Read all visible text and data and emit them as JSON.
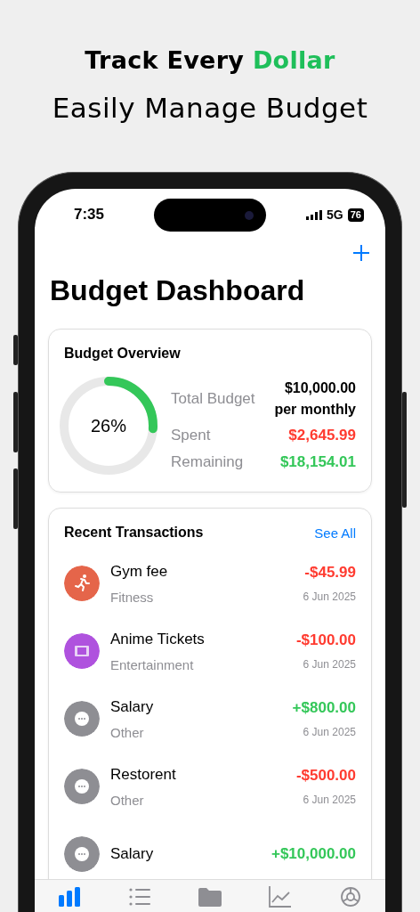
{
  "headline": {
    "parts": [
      {
        "text": "Track Every ",
        "highlight": false
      },
      {
        "text": "Dollar",
        "highlight": true
      }
    ],
    "subtitle": "Easily Manage Budget"
  },
  "status_bar": {
    "time": "7:35",
    "network": "5G",
    "battery": "76"
  },
  "title": "Budget Dashboard",
  "overview": {
    "title": "Budget Overview",
    "level": 0.26,
    "percent": "26%",
    "rows": [
      {
        "label": "Total Budget",
        "value": "$10,000.00",
        "note": "per monthly",
        "kind": "total"
      },
      {
        "label": "Spent",
        "value": "$2,645.99",
        "kind": "spent"
      },
      {
        "label": "Remaining",
        "value": "$18,154.01",
        "kind": "remaining"
      }
    ]
  },
  "transactions": {
    "title": "Recent Transactions",
    "link": "See All",
    "items": [
      {
        "name": "Gym fee",
        "category": "Fitness",
        "amount": "-$45.99",
        "date": "6 Jun 2025",
        "kind": "fitness",
        "color": "#e5654a",
        "income": false
      },
      {
        "name": "Anime Tickets",
        "category": "Entertainment",
        "amount": "-$100.00",
        "date": "6 Jun 2025",
        "kind": "entertainment",
        "color": "#af52de",
        "income": false
      },
      {
        "name": "Salary",
        "category": "Other",
        "amount": "+$800.00",
        "date": "6 Jun 2025",
        "kind": "other",
        "color": "#8e8e93",
        "income": true
      },
      {
        "name": "Restorent",
        "category": "Other",
        "amount": "-$500.00",
        "date": "6 Jun 2025",
        "kind": "other",
        "color": "#8e8e93",
        "income": false
      },
      {
        "name": "Salary",
        "amount": "+$10,000.00",
        "kind": "other",
        "color": "#8e8e93",
        "income": true
      }
    ]
  },
  "tabs": [
    {
      "kind": "dashboard",
      "selected": true
    },
    {
      "kind": "transactions",
      "selected": false
    },
    {
      "kind": "categories",
      "selected": false
    },
    {
      "kind": "analytics",
      "selected": false
    },
    {
      "kind": "settings",
      "selected": false
    }
  ]
}
